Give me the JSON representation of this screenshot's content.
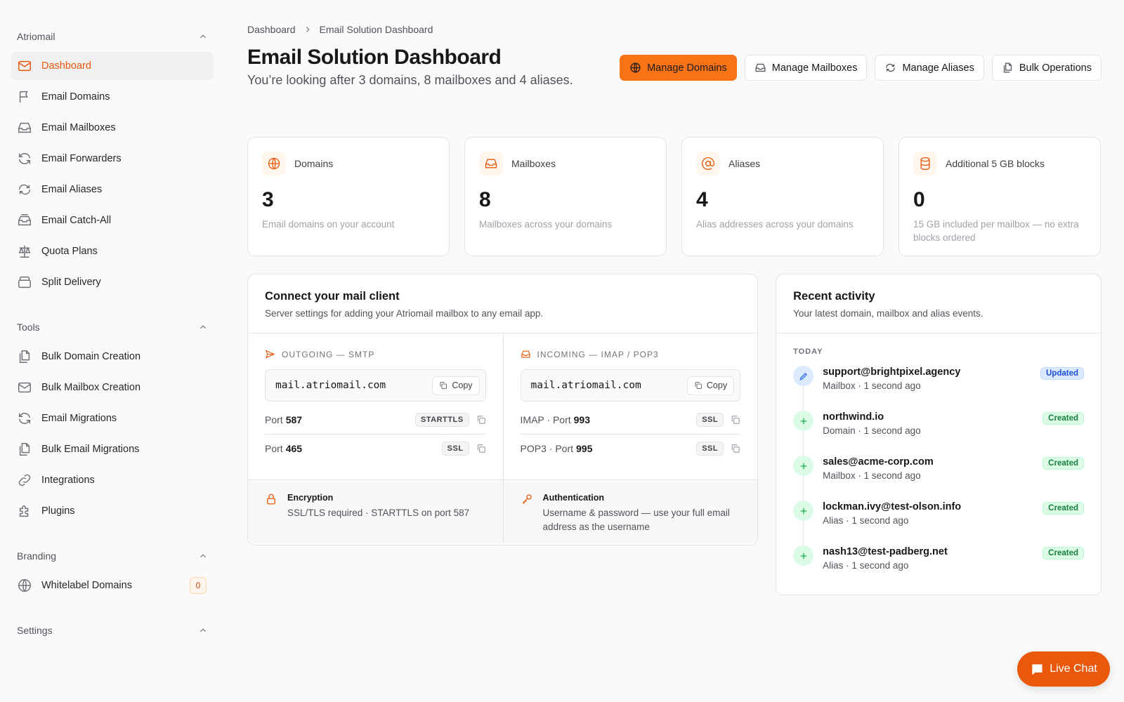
{
  "sidebar": {
    "groups": [
      {
        "title": "Atriomail",
        "items": [
          {
            "label": "Dashboard",
            "icon": "mail-icon",
            "active": true
          },
          {
            "label": "Email Domains",
            "icon": "flag-icon"
          },
          {
            "label": "Email Mailboxes",
            "icon": "inbox-icon"
          },
          {
            "label": "Email Forwarders",
            "icon": "refresh-icon"
          },
          {
            "label": "Email Aliases",
            "icon": "repeat-icon"
          },
          {
            "label": "Email Catch-All",
            "icon": "inbox-stack-icon"
          },
          {
            "label": "Quota Plans",
            "icon": "scale-icon"
          },
          {
            "label": "Split Delivery",
            "icon": "archive-icon"
          }
        ]
      },
      {
        "title": "Tools",
        "items": [
          {
            "label": "Bulk Domain Creation",
            "icon": "files-icon"
          },
          {
            "label": "Bulk Mailbox Creation",
            "icon": "mail-icon"
          },
          {
            "label": "Email Migrations",
            "icon": "refresh-icon"
          },
          {
            "label": "Bulk Email Migrations",
            "icon": "files-icon"
          },
          {
            "label": "Integrations",
            "icon": "link-icon"
          },
          {
            "label": "Plugins",
            "icon": "puzzle-icon"
          }
        ]
      },
      {
        "title": "Branding",
        "items": [
          {
            "label": "Whitelabel Domains",
            "icon": "globe-icon",
            "count": "0"
          }
        ]
      },
      {
        "title": "Settings",
        "items": []
      }
    ]
  },
  "breadcrumb": {
    "root": "Dashboard",
    "current": "Email Solution Dashboard"
  },
  "header": {
    "title": "Email Solution Dashboard",
    "subtitle": "You’re looking after 3 domains, 8 mailboxes and 4 aliases."
  },
  "actions": {
    "manage_domains": "Manage Domains",
    "manage_mailboxes": "Manage Mailboxes",
    "manage_aliases": "Manage Aliases",
    "bulk_operations": "Bulk Operations"
  },
  "stats": [
    {
      "label": "Domains",
      "value": "3",
      "desc": "Email domains on your account",
      "icon": "globe-icon"
    },
    {
      "label": "Mailboxes",
      "value": "8",
      "desc": "Mailboxes across your domains",
      "icon": "inbox-icon"
    },
    {
      "label": "Aliases",
      "value": "4",
      "desc": "Alias addresses across your domains",
      "icon": "at-sign-icon"
    },
    {
      "label": "Additional 5 GB blocks",
      "value": "0",
      "desc": "15 GB included per mailbox — no extra blocks ordered",
      "icon": "database-icon"
    }
  ],
  "client": {
    "title": "Connect your mail client",
    "subtitle": "Server settings for adding your Atriomail mailbox to any email app.",
    "copy_label": "Copy",
    "outgoing": {
      "label": "OUTGOING — SMTP",
      "host": "mail.atriomail.com",
      "rows": [
        {
          "prefix": "Port",
          "port": "587",
          "security": "STARTTLS"
        },
        {
          "prefix": "Port",
          "port": "465",
          "security": "SSL"
        }
      ]
    },
    "incoming": {
      "label": "INCOMING — IMAP / POP3",
      "host": "mail.atriomail.com",
      "rows": [
        {
          "prefix": "IMAP · Port",
          "port": "993",
          "security": "SSL"
        },
        {
          "prefix": "POP3 · Port",
          "port": "995",
          "security": "SSL"
        }
      ]
    },
    "encryption": {
      "title": "Encryption",
      "text": "SSL/TLS required · STARTTLS on port 587"
    },
    "authentication": {
      "title": "Authentication",
      "text": "Username & password — use your full email address as the username"
    }
  },
  "activity": {
    "title": "Recent activity",
    "subtitle": "Your latest domain, mailbox and alias events.",
    "day": "TODAY",
    "items": [
      {
        "name": "support@brightpixel.agency",
        "meta": "Mailbox · 1 second ago",
        "status": "Updated",
        "kind": "updated"
      },
      {
        "name": "northwind.io",
        "meta": "Domain · 1 second ago",
        "status": "Created",
        "kind": "created"
      },
      {
        "name": "sales@acme-corp.com",
        "meta": "Mailbox · 1 second ago",
        "status": "Created",
        "kind": "created"
      },
      {
        "name": "lockman.ivy@test-olson.info",
        "meta": "Alias · 1 second ago",
        "status": "Created",
        "kind": "created"
      },
      {
        "name": "nash13@test-padberg.net",
        "meta": "Alias · 1 second ago",
        "status": "Created",
        "kind": "created"
      }
    ]
  },
  "live_chat": {
    "label": "Live Chat"
  },
  "colors": {
    "accent": "#f97316",
    "accent_dark": "#ea580c",
    "updated": "#2563eb",
    "created": "#16a34a"
  }
}
